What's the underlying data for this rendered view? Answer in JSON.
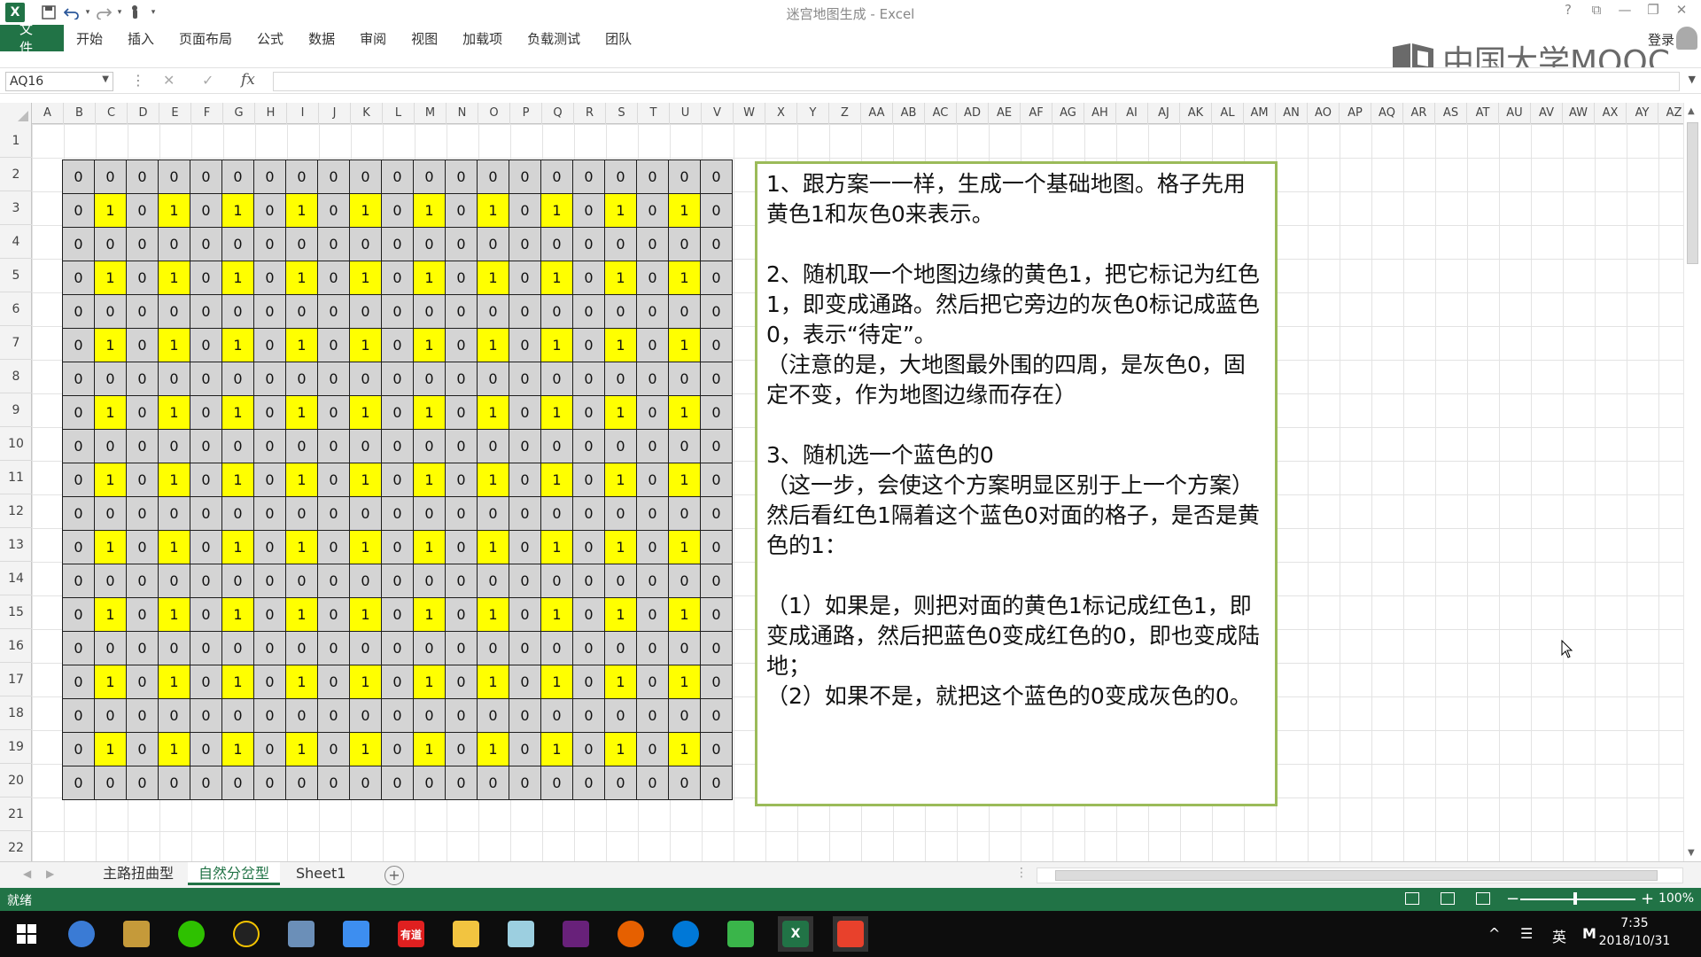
{
  "window": {
    "title": "迷宫地图生成 - Excel",
    "logo_text": "X",
    "controls": [
      "?",
      "⧉",
      "—",
      "❐",
      "✕"
    ]
  },
  "quick_access": {
    "save_icon": "save-icon",
    "undo_icon": "undo-icon",
    "redo_icon": "redo-icon",
    "touch_icon": "touch-mode-icon"
  },
  "ribbon": {
    "tabs": [
      "文件",
      "开始",
      "插入",
      "页面布局",
      "公式",
      "数据",
      "审阅",
      "视图",
      "加载项",
      "负载测试",
      "团队"
    ],
    "login": "登录"
  },
  "watermark": {
    "text": "中国大学MOOC"
  },
  "formula_bar": {
    "name_box": "AQ16",
    "cancel_symbol": "✕",
    "enter_symbol": "✓",
    "fx_label": "fx",
    "formula": ""
  },
  "columns": [
    "A",
    "B",
    "C",
    "D",
    "E",
    "F",
    "G",
    "H",
    "I",
    "J",
    "K",
    "L",
    "M",
    "N",
    "O",
    "P",
    "Q",
    "R",
    "S",
    "T",
    "U",
    "V",
    "W",
    "X",
    "Y",
    "Z",
    "AA",
    "AB",
    "AC",
    "AD",
    "AE",
    "AF",
    "AG",
    "AH",
    "AI",
    "AJ",
    "AK",
    "AL",
    "AM",
    "AN",
    "AO",
    "AP",
    "AQ",
    "AR",
    "AS",
    "AT",
    "AU",
    "AV",
    "AW",
    "AX",
    "AY",
    "AZ"
  ],
  "rows": [
    "1",
    "2",
    "3",
    "4",
    "5",
    "6",
    "7",
    "8",
    "9",
    "10",
    "11",
    "12",
    "13",
    "14",
    "15",
    "16",
    "17",
    "18",
    "19",
    "20",
    "21",
    "22"
  ],
  "maze": {
    "rows": [
      [
        "0",
        "0",
        "0",
        "0",
        "0",
        "0",
        "0",
        "0",
        "0",
        "0",
        "0",
        "0",
        "0",
        "0",
        "0",
        "0",
        "0",
        "0",
        "0",
        "0",
        "0"
      ],
      [
        "0",
        "1",
        "0",
        "1",
        "0",
        "1",
        "0",
        "1",
        "0",
        "1",
        "0",
        "1",
        "0",
        "1",
        "0",
        "1",
        "0",
        "1",
        "0",
        "1",
        "0"
      ],
      [
        "0",
        "0",
        "0",
        "0",
        "0",
        "0",
        "0",
        "0",
        "0",
        "0",
        "0",
        "0",
        "0",
        "0",
        "0",
        "0",
        "0",
        "0",
        "0",
        "0",
        "0"
      ],
      [
        "0",
        "1",
        "0",
        "1",
        "0",
        "1",
        "0",
        "1",
        "0",
        "1",
        "0",
        "1",
        "0",
        "1",
        "0",
        "1",
        "0",
        "1",
        "0",
        "1",
        "0"
      ],
      [
        "0",
        "0",
        "0",
        "0",
        "0",
        "0",
        "0",
        "0",
        "0",
        "0",
        "0",
        "0",
        "0",
        "0",
        "0",
        "0",
        "0",
        "0",
        "0",
        "0",
        "0"
      ],
      [
        "0",
        "1",
        "0",
        "1",
        "0",
        "1",
        "0",
        "1",
        "0",
        "1",
        "0",
        "1",
        "0",
        "1",
        "0",
        "1",
        "0",
        "1",
        "0",
        "1",
        "0"
      ],
      [
        "0",
        "0",
        "0",
        "0",
        "0",
        "0",
        "0",
        "0",
        "0",
        "0",
        "0",
        "0",
        "0",
        "0",
        "0",
        "0",
        "0",
        "0",
        "0",
        "0",
        "0"
      ],
      [
        "0",
        "1",
        "0",
        "1",
        "0",
        "1",
        "0",
        "1",
        "0",
        "1",
        "0",
        "1",
        "0",
        "1",
        "0",
        "1",
        "0",
        "1",
        "0",
        "1",
        "0"
      ],
      [
        "0",
        "0",
        "0",
        "0",
        "0",
        "0",
        "0",
        "0",
        "0",
        "0",
        "0",
        "0",
        "0",
        "0",
        "0",
        "0",
        "0",
        "0",
        "0",
        "0",
        "0"
      ],
      [
        "0",
        "1",
        "0",
        "1",
        "0",
        "1",
        "0",
        "1",
        "0",
        "1",
        "0",
        "1",
        "0",
        "1",
        "0",
        "1",
        "0",
        "1",
        "0",
        "1",
        "0"
      ],
      [
        "0",
        "0",
        "0",
        "0",
        "0",
        "0",
        "0",
        "0",
        "0",
        "0",
        "0",
        "0",
        "0",
        "0",
        "0",
        "0",
        "0",
        "0",
        "0",
        "0",
        "0"
      ],
      [
        "0",
        "1",
        "0",
        "1",
        "0",
        "1",
        "0",
        "1",
        "0",
        "1",
        "0",
        "1",
        "0",
        "1",
        "0",
        "1",
        "0",
        "1",
        "0",
        "1",
        "0"
      ],
      [
        "0",
        "0",
        "0",
        "0",
        "0",
        "0",
        "0",
        "0",
        "0",
        "0",
        "0",
        "0",
        "0",
        "0",
        "0",
        "0",
        "0",
        "0",
        "0",
        "0",
        "0"
      ],
      [
        "0",
        "1",
        "0",
        "1",
        "0",
        "1",
        "0",
        "1",
        "0",
        "1",
        "0",
        "1",
        "0",
        "1",
        "0",
        "1",
        "0",
        "1",
        "0",
        "1",
        "0"
      ],
      [
        "0",
        "0",
        "0",
        "0",
        "0",
        "0",
        "0",
        "0",
        "0",
        "0",
        "0",
        "0",
        "0",
        "0",
        "0",
        "0",
        "0",
        "0",
        "0",
        "0",
        "0"
      ],
      [
        "0",
        "1",
        "0",
        "1",
        "0",
        "1",
        "0",
        "1",
        "0",
        "1",
        "0",
        "1",
        "0",
        "1",
        "0",
        "1",
        "0",
        "1",
        "0",
        "1",
        "0"
      ],
      [
        "0",
        "0",
        "0",
        "0",
        "0",
        "0",
        "0",
        "0",
        "0",
        "0",
        "0",
        "0",
        "0",
        "0",
        "0",
        "0",
        "0",
        "0",
        "0",
        "0",
        "0"
      ],
      [
        "0",
        "1",
        "0",
        "1",
        "0",
        "1",
        "0",
        "1",
        "0",
        "1",
        "0",
        "1",
        "0",
        "1",
        "0",
        "1",
        "0",
        "1",
        "0",
        "1",
        "0"
      ],
      [
        "0",
        "0",
        "0",
        "0",
        "0",
        "0",
        "0",
        "0",
        "0",
        "0",
        "0",
        "0",
        "0",
        "0",
        "0",
        "0",
        "0",
        "0",
        "0",
        "0",
        "0"
      ]
    ],
    "colors": {
      "yellow": "#ffff00",
      "gray": "#d4d4d4"
    }
  },
  "notes": {
    "p1": "1、跟方案一一样，生成一个基础地图。格子先用黄色1和灰色0来表示。",
    "p2": "2、随机取一个地图边缘的黄色1，把它标记为红色1，即变成通路。然后把它旁边的灰色0标记成蓝色0，表示“待定”。",
    "p3": "（注意的是，大地图最外围的四周，是灰色0，固定不变，作为地图边缘而存在）",
    "p4": "3、随机选一个蓝色的0",
    "p5": "（这一步，会使这个方案明显区别于上一个方案）然后看红色1隔着这个蓝色0对面的格子，是否是黄色的1：",
    "p6": "（1）如果是，则把对面的黄色1标记成红色1，即变成通路，然后把蓝色0变成红色的0，即也变成陆地；",
    "p7": "（2）如果不是，就把这个蓝色的0变成灰色的0。",
    "border_color": "#9bbb59"
  },
  "sheets": {
    "tabs": [
      "主路扭曲型",
      "自然分岔型",
      "Sheet1"
    ],
    "active": "自然分岔型"
  },
  "status": {
    "text": "就绪",
    "zoom": "100%"
  },
  "taskbar": {
    "apps": [
      "baidu-netdisk-icon",
      "tools-icon",
      "wechat-icon",
      "qq-icon",
      "files-icon",
      "feishu-icon",
      "youdao-icon",
      "file-explorer-icon",
      "notepad-icon",
      "visual-studio-icon",
      "firefox-icon",
      "edge-icon",
      "camtasia-icon",
      "excel-icon",
      "recorder-icon"
    ],
    "youdao_label": "有道",
    "ime": "英",
    "time": "7:35",
    "date": "2018/10/31"
  },
  "theme": {
    "excel_green": "#217346"
  }
}
